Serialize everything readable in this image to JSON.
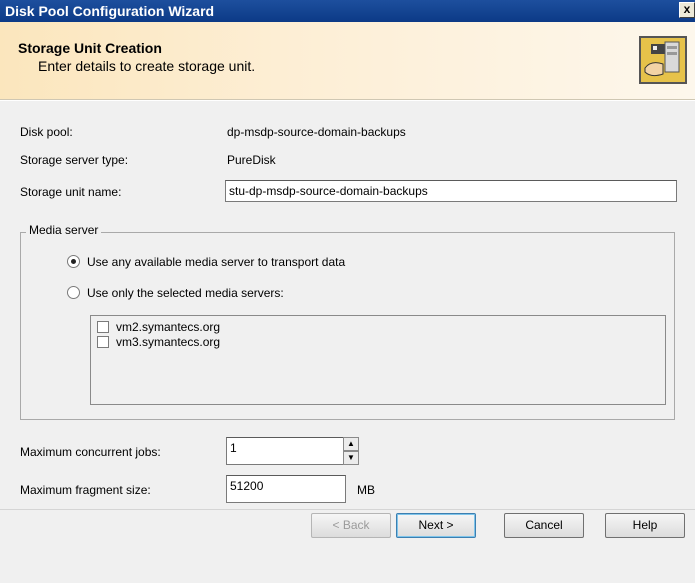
{
  "window": {
    "title": "Disk Pool Configuration Wizard",
    "close_label": "x"
  },
  "header": {
    "title": "Storage Unit Creation",
    "subtitle": "Enter details to create storage unit.",
    "icon": "storage-wizard-icon"
  },
  "form": {
    "disk_pool_label": "Disk pool:",
    "disk_pool_value": "dp-msdp-source-domain-backups",
    "server_type_label": "Storage server type:",
    "server_type_value": "PureDisk",
    "unit_name_label": "Storage unit name:",
    "unit_name_value": "stu-dp-msdp-source-domain-backups"
  },
  "media_server": {
    "group_label": "Media server",
    "option_any": "Use any available media server to transport data",
    "option_selected": "Use only the selected media servers:",
    "selected_option": "any",
    "servers": [
      {
        "name": "vm2.symantecs.org",
        "checked": false
      },
      {
        "name": "vm3.symantecs.org",
        "checked": false
      }
    ]
  },
  "limits": {
    "max_jobs_label": "Maximum concurrent jobs:",
    "max_jobs_value": "1",
    "max_fragment_label": "Maximum fragment size:",
    "max_fragment_value": "51200",
    "fragment_unit": "MB"
  },
  "buttons": {
    "back": "< Back",
    "next": "Next >",
    "cancel": "Cancel",
    "help": "Help"
  }
}
